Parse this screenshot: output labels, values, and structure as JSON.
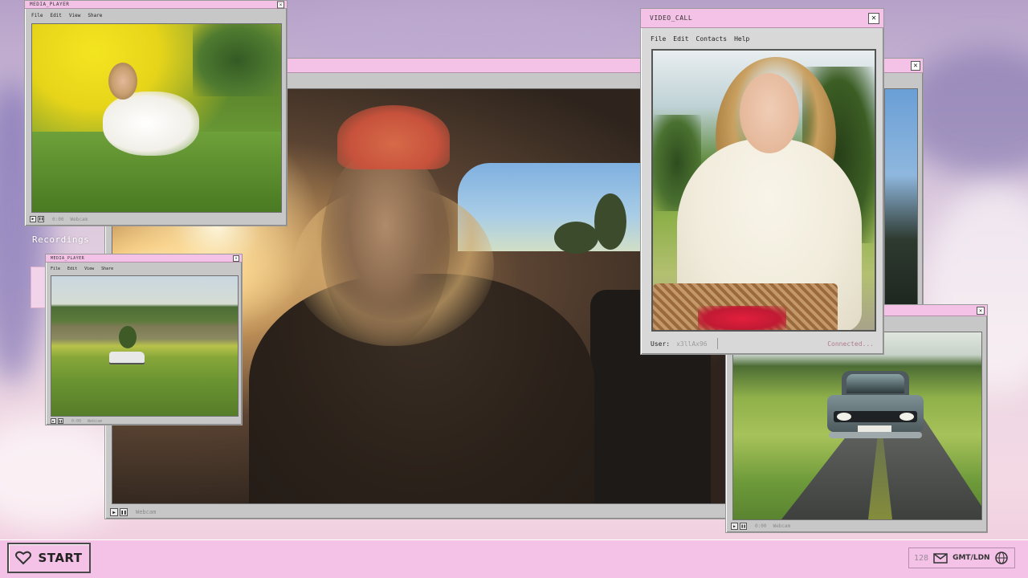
{
  "desktop": {
    "label": "Recordings"
  },
  "main_window": {
    "ctrl_text": "Webcam"
  },
  "media_player_1": {
    "title": "MEDIA_PLAYER",
    "menu": [
      "File",
      "Edit",
      "View",
      "Share"
    ],
    "ctrl_time": "0:00",
    "ctrl_text": "Webcam"
  },
  "media_player_2": {
    "title": "MEDIA_PLAYER",
    "menu": [
      "File",
      "Edit",
      "View",
      "Share"
    ],
    "ctrl_time": "0:00",
    "ctrl_text": "Webcam"
  },
  "video_call": {
    "title": "VIDEO_CALL",
    "menu": [
      "File",
      "Edit",
      "Contacts",
      "Help"
    ],
    "user_label": "User:",
    "user_value": "x3llAx96",
    "status": "Connected..."
  },
  "car_player": {
    "ctrl_time": "0:00",
    "ctrl_text": "Webcam"
  },
  "taskbar": {
    "start_label": "START",
    "tray_count": "128",
    "timezone": "GMT/LDN"
  },
  "icons": {
    "close": "close-icon",
    "play": "play-icon",
    "pause": "pause-icon",
    "heart": "heart-icon",
    "mail": "mail-icon",
    "globe": "globe-icon"
  },
  "colors": {
    "accent_pink": "#f3c2e6",
    "window_gray": "#c7c7c7",
    "connected_text": "#b07a8e"
  }
}
